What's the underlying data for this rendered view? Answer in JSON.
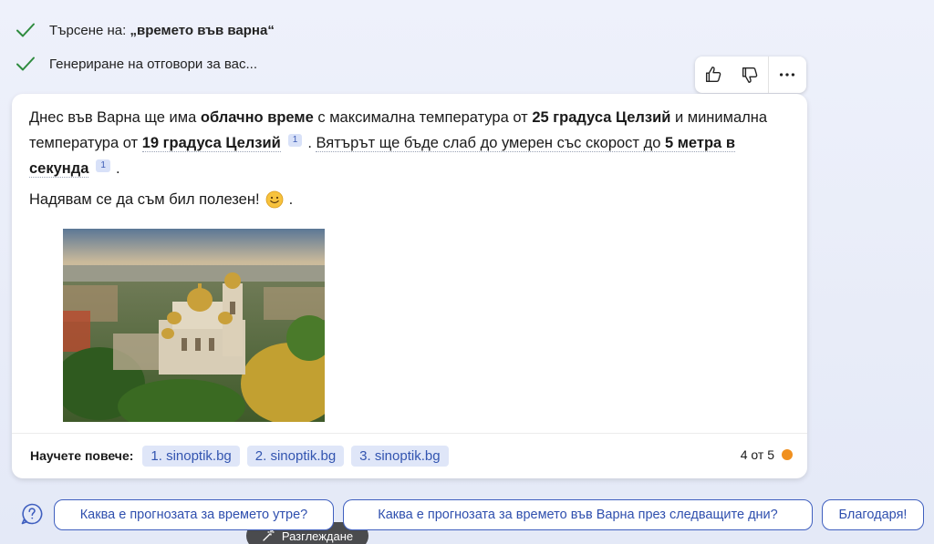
{
  "status": {
    "search_prefix": "Търсене на: ",
    "search_query": "„времето във варна“",
    "generating": "Генериране на отговори за вас..."
  },
  "answer": {
    "p1_a": "Днес във Варна ще има ",
    "p1_b": "облачно време",
    "p1_c": " с максимална температура от ",
    "p1_d": "25 градуса Целзий",
    "p1_e": " и минимална температура от ",
    "p1_f": "19 градуса Целзий",
    "cite1": "1",
    "p1_g": ". ",
    "p1_h": "Вятърът ще бъде слаб до умерен със скорост до ",
    "p1_i": "5 метра в секунда",
    "cite2": "1",
    "p1_j": ".",
    "thanks": "Надявам се да съм бил полезен!",
    "thanks_end": "."
  },
  "image": {
    "explore_label": "Разглеждане"
  },
  "learn_more": {
    "label": "Научете повече:",
    "sources": [
      "1. sinoptik.bg",
      "2. sinoptik.bg",
      "3. sinoptik.bg"
    ]
  },
  "counter": {
    "text": "4 от 5",
    "dot_color": "#f0901f"
  },
  "suggestions": [
    "Каква е прогнозата за времето утре?",
    "Каква е прогнозата за времето във Варна през следващите дни?",
    "Благодаря!"
  ],
  "colors": {
    "accent": "#3f5fbf",
    "check": "#2e8b3e"
  }
}
